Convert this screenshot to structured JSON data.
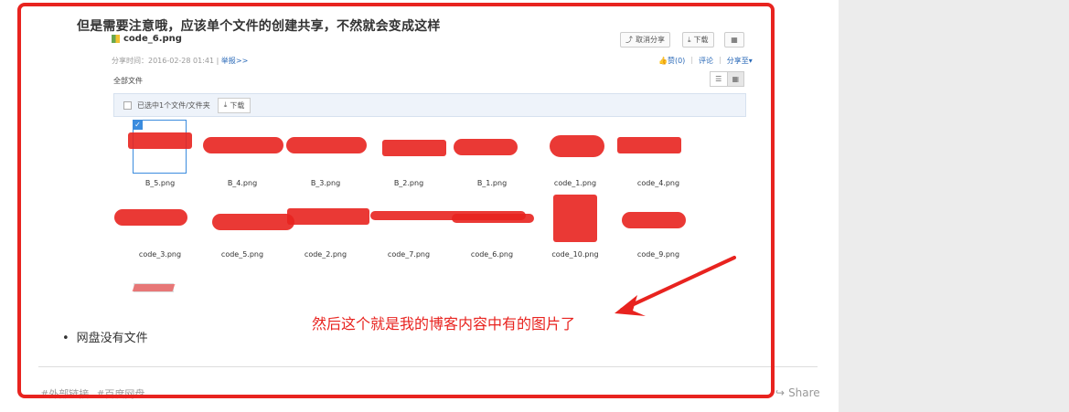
{
  "heading": "但是需要注意哦，应该单个文件的创建共享，不然就会变成这样",
  "file_title": "code_6.png",
  "buttons": {
    "cancel_share": "取消分享",
    "download": "下载"
  },
  "meta": {
    "share_time": "分享时间：2016-02-28 01:41 |",
    "report": "举报>>"
  },
  "meta_right": {
    "like": "赞(0)",
    "comment": "评论",
    "share_to": "分享至"
  },
  "all_files": "全部文件",
  "selection": {
    "text": "已选中1个文件/文件夹",
    "download": "下载"
  },
  "files": [
    "B_5.png",
    "B_4.png",
    "B_3.png",
    "B_2.png",
    "B_1.png",
    "code_1.png",
    "code_4.png",
    "code_3.png",
    "code_5.png",
    "code_2.png",
    "code_7.png",
    "code_6.png",
    "code_10.png",
    "code_9.png"
  ],
  "annotation": "然后这个就是我的博客内容中有的图片了",
  "bullet": "网盘没有文件",
  "tags": [
    "#外部链接",
    "#百度网盘"
  ],
  "share": "Share",
  "colors": {
    "accent": "#e8231f",
    "link": "#2b6ab8"
  }
}
